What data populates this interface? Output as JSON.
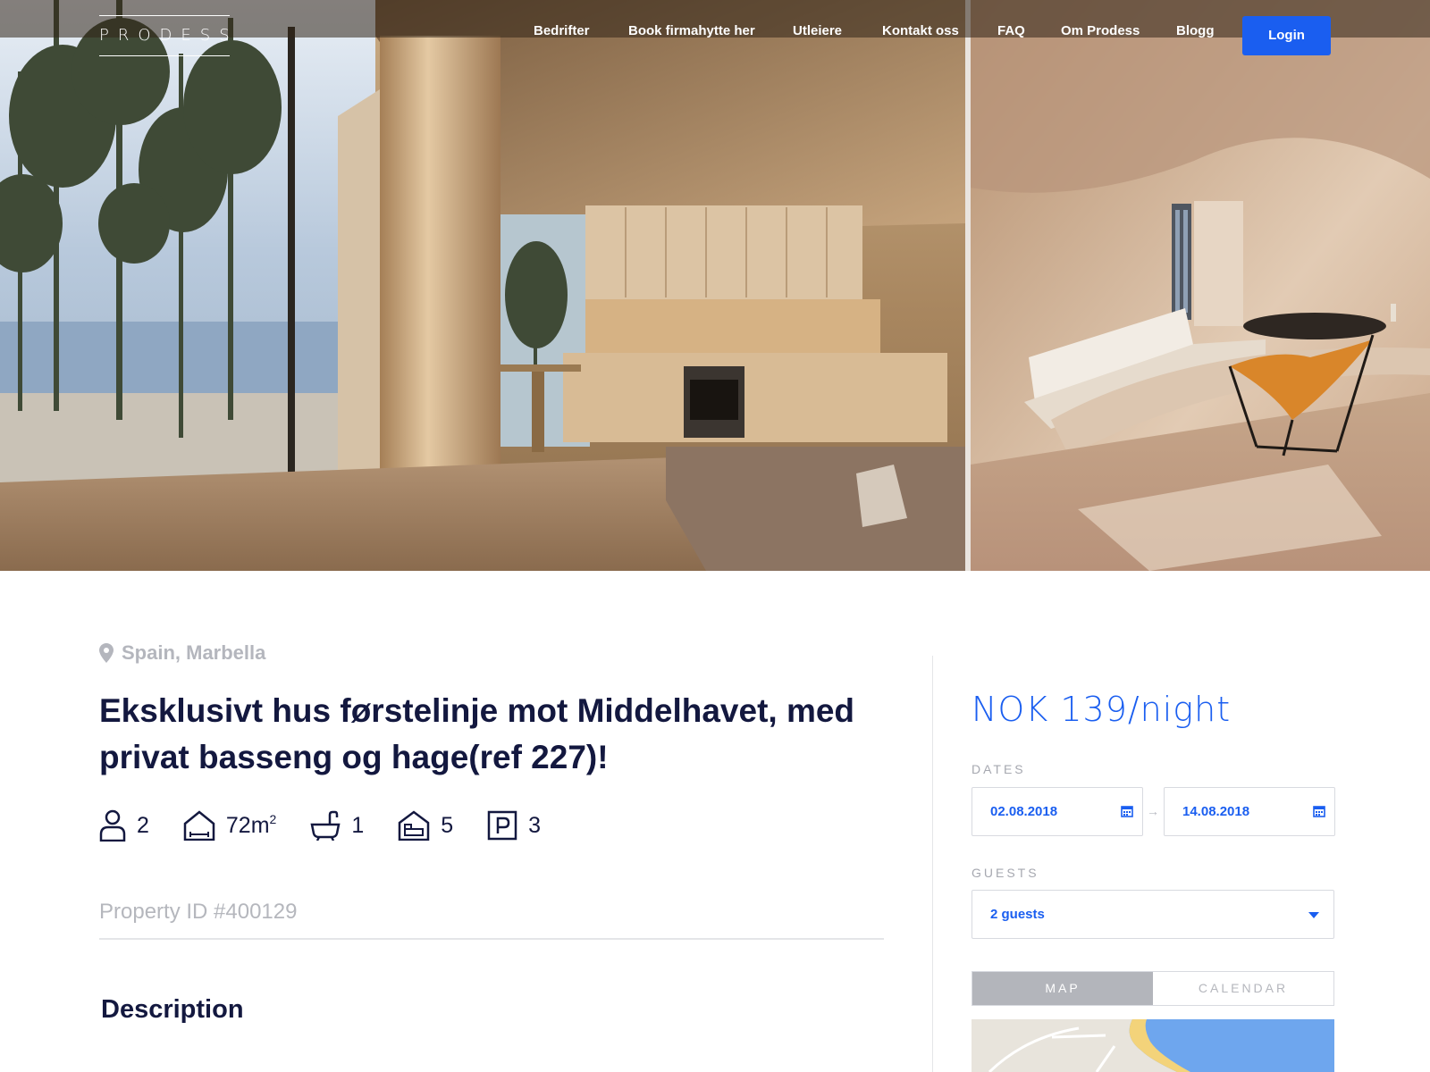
{
  "brand": {
    "logo_text": "PRODESS"
  },
  "nav": {
    "items": [
      {
        "label": "Bedrifter"
      },
      {
        "label": "Book firmahytte her"
      },
      {
        "label": "Utleiere"
      },
      {
        "label": "Kontakt oss"
      },
      {
        "label": "FAQ"
      },
      {
        "label": "Om Prodess"
      },
      {
        "label": "Blogg"
      }
    ],
    "login_label": "Login"
  },
  "listing": {
    "location": "Spain, Marbella",
    "title": "Eksklusivt hus førstelinje mot Middelhavet, med privat basseng og hage(ref 227)!",
    "features": {
      "guests": "2",
      "area": "72m",
      "area_unit_sup": "2",
      "bathrooms": "1",
      "bedrooms": "5",
      "parking": "3"
    },
    "property_id": "Property ID #400129",
    "description_heading": "Description"
  },
  "booking": {
    "price": "NOK 139/night",
    "dates_label": "DATES",
    "date_from": "02.08.2018",
    "date_to": "14.08.2018",
    "guests_label": "GUESTS",
    "guests_value": "2 guests",
    "tabs": [
      {
        "label": "MAP",
        "active": true
      },
      {
        "label": "CALENDAR",
        "active": false
      }
    ]
  },
  "icons": {
    "location": "location-pin-icon",
    "guests": "person-icon",
    "area": "house-icon",
    "bath": "bathtub-icon",
    "bed": "bed-icon",
    "parking": "parking-icon",
    "calendar": "calendar-icon",
    "caret": "chevron-down-icon"
  },
  "colors": {
    "accent": "#1a5ef0",
    "heading": "#13183f",
    "muted": "#b4b6bd"
  }
}
